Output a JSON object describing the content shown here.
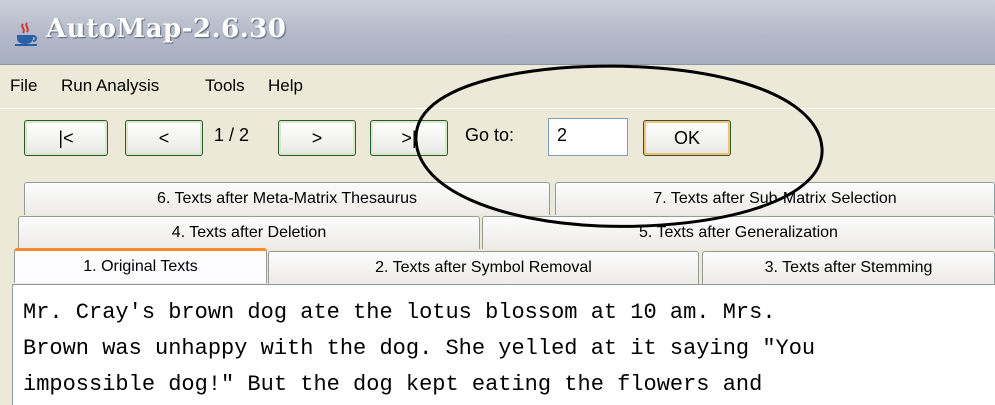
{
  "window": {
    "title": "AutoMap-2.6.30",
    "icon": "java-coffee-cup-icon"
  },
  "menubar": {
    "items": [
      "File",
      "Run Analysis",
      "Tools",
      "Help"
    ]
  },
  "toolbar": {
    "first_label": "|<",
    "prev_label": "<",
    "page_indicator": "1 / 2",
    "next_label": ">",
    "last_label": ">|",
    "goto_label": "Go to:",
    "goto_value": "2",
    "ok_label": "OK"
  },
  "tabs": {
    "row1": [
      "6. Texts after Meta-Matrix Thesaurus",
      "7. Texts after Sub-Matrix Selection"
    ],
    "row2": [
      "4. Texts after Deletion",
      "5. Texts after Generalization"
    ],
    "row3": [
      "1. Original Texts",
      "2. Texts after Symbol Removal",
      "3. Texts after Stemming"
    ],
    "active": "1. Original Texts"
  },
  "content": {
    "text": "Mr. Cray's brown dog ate the lotus blossom at 10 am. Mrs.\nBrown was unhappy with the dog. She yelled at it saying \"You\nimpossible dog!\" But the dog kept eating the flowers and"
  },
  "colors": {
    "annotation_ellipse": "#000000",
    "active_tab_accent": "#ff8b2e",
    "ok_focus": "#f6c07a"
  }
}
